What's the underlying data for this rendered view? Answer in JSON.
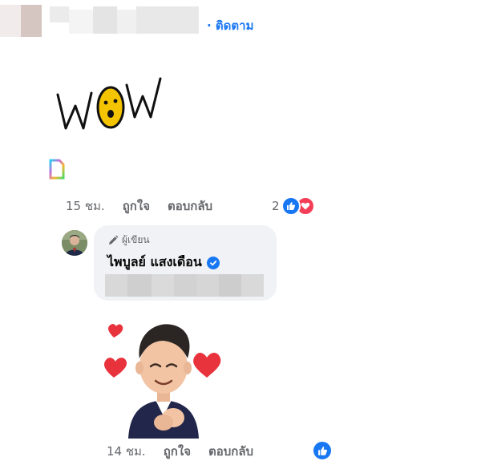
{
  "header": {
    "follow_label": "· ติดตาม"
  },
  "comment": {
    "sticker_text": "WOW",
    "time": "15 ชม.",
    "like_label": "ถูกใจ",
    "reply_label": "ตอบกลับ",
    "reaction_count": "2"
  },
  "reply": {
    "author_badge": "ผู้เขียน",
    "author_name": "ไพบูลย์ แสงเดือน",
    "time": "14 ชม.",
    "like_label": "ถูกใจ",
    "reply_label": "ตอบกลับ"
  },
  "colors": {
    "link_blue": "#1877f2",
    "like_blue": "#1877f2",
    "love_red": "#f33e58"
  }
}
